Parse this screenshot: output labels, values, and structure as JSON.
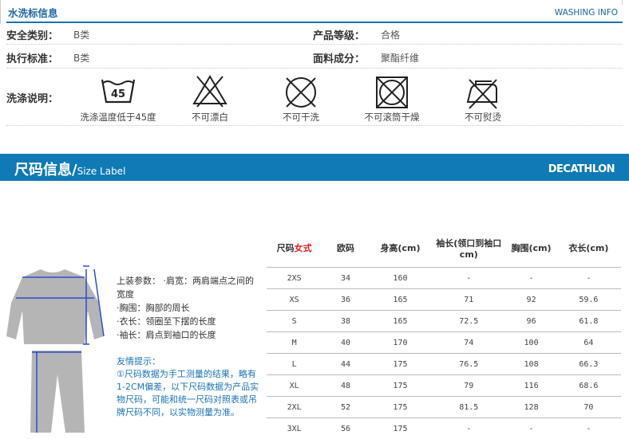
{
  "wash": {
    "title": "水洗标信息",
    "title_en": "WASHING INFO",
    "rows": [
      {
        "label": "安全类别：",
        "value": "B类",
        "label2": "产品等级：",
        "value2": "合格"
      },
      {
        "label": "执行标准：",
        "value": "B类",
        "label2": "面料成分：",
        "value2": "聚酯纤维"
      }
    ],
    "care_label": "洗涤说明：",
    "care_icons": [
      {
        "icon": "wash-45-icon",
        "temp": "45",
        "caption": "洗涤温度低于45度"
      },
      {
        "icon": "no-bleach-icon",
        "caption": "不可漂白"
      },
      {
        "icon": "no-dry-clean-icon",
        "caption": "不可干洗"
      },
      {
        "icon": "no-tumble-dry-icon",
        "caption": "不可滚筒干燥"
      },
      {
        "icon": "no-iron-icon",
        "caption": "不可熨烫"
      }
    ]
  },
  "size": {
    "banner_title": "尺码信息/",
    "banner_title_en": "Size Label",
    "brand": "DECATHLON",
    "table": {
      "headers": {
        "size": "尺码",
        "size_red": "女式",
        "eu": "欧码",
        "height": "身高(cm)",
        "sleeve": "袖长(领口到袖口cm)",
        "chest": "胸围(cm)",
        "length": "衣长(cm)"
      },
      "rows": [
        [
          "2XS",
          "34",
          "160",
          "-",
          "-",
          "-"
        ],
        [
          "XS",
          "36",
          "165",
          "71",
          "92",
          "59.6"
        ],
        [
          "S",
          "38",
          "165",
          "72.5",
          "96",
          "61.8"
        ],
        [
          "M",
          "40",
          "170",
          "74",
          "100",
          "64"
        ],
        [
          "L",
          "44",
          "175",
          "76.5",
          "108",
          "66.3"
        ],
        [
          "XL",
          "48",
          "175",
          "79",
          "116",
          "68.6"
        ],
        [
          "2XL",
          "52",
          "175",
          "81.5",
          "128",
          "70"
        ],
        [
          "3XL",
          "56",
          "175",
          "-",
          "-",
          "-"
        ]
      ]
    },
    "info": {
      "line1": "上装参数： ·肩宽：两肩端点之间的宽度",
      "line2": "·胸围：胸部的周长",
      "line3": "·衣长：领圈至下摆的长度",
      "line4": "·袖长：肩点到袖口的长度"
    },
    "tips_title": "友情提示：",
    "tips_text": "①尺码数据为手工测量的结果，略有1-2CM偏差，以下尺码数据为产品实物尺码，可能和统一尺码对照表或吊牌尺码不同，以实物测量为准。"
  },
  "colors": {
    "accent": "#1a74b8",
    "banner": "#0f7ab6",
    "highlight": "#e02020"
  }
}
